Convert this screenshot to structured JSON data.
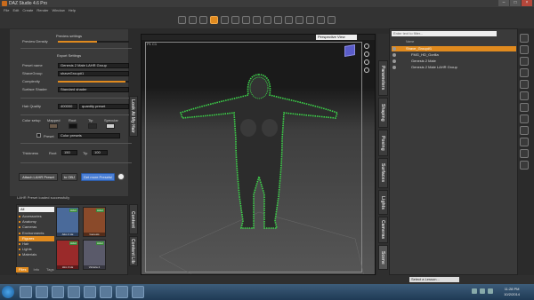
{
  "app": {
    "title": "DAZ Studio 4.6 Pro"
  },
  "menu": [
    "File",
    "Edit",
    "Create",
    "Render",
    "Window",
    "Help"
  ],
  "left_panel": {
    "preview_settings_title": "Preview settings",
    "preview_density_label": "Preview Density",
    "preview_density_fraction": 0.55,
    "export_settings_title": "Export Settings",
    "preset_name_label": "Preset name",
    "preset_name_value": "Genesis 2 Male LAHR Group",
    "shave_group_label": "ShaveGroup",
    "shave_group_value": "shaveGroup#1",
    "complexity_label": "Complexity",
    "complexity_fraction": 0.95,
    "surface_shader_label": "Surface Shader",
    "surface_shader_value": "Standard shader",
    "hair_quality_label": "Hair Quality",
    "hair_quality_value": "400000",
    "hair_quality_preset": "quantity preset",
    "color_setup_label": "Color setup",
    "color_cols": [
      "Mapped",
      "Root",
      "Tip",
      "Specular"
    ],
    "color_swatches": [
      "#6b5a4a",
      "#111111",
      "#2a2a2a",
      "#cfcfcf"
    ],
    "preset_label": "Preset",
    "color_presets_value": "Color presets",
    "thickness_label": "Thickness",
    "root_label": "Root",
    "root_value": "150",
    "tip_label": "Tip",
    "tip_value": "100",
    "attach_button": "Attach LAHR Preset",
    "to_obj_button": "to OBJ",
    "get_more_button": "Get more Presets!",
    "status_message": "LAHR Preset loaded successfully",
    "tab_look_at_hair": "Look At My Hair",
    "tab_content": "Content",
    "tab_content_lib": "Content Lib"
  },
  "content_library": {
    "filter": "All",
    "categories": [
      "Accessories",
      "Anatomy",
      "Cameras",
      "Environments",
      "Figures",
      "Hair",
      "Lights",
      "Materials"
    ],
    "selected_category": "Figures",
    "thumbs": [
      {
        "caption": "Aiko 3 LE",
        "badge": "Actor",
        "color": "#4a6a9a"
      },
      {
        "caption": "Genesis",
        "badge": "Actor",
        "color": "#8a4a2a"
      },
      {
        "caption": "Hiro 3 LE",
        "badge": "Actor",
        "color": "#9a2a2a"
      },
      {
        "caption": "Victoria 4",
        "badge": "Actor",
        "color": "#5a5a6a"
      }
    ],
    "tabs": [
      "Files",
      "Info",
      "Tags"
    ],
    "active_tab": "Files"
  },
  "viewport": {
    "view_dropdown": "Perspective View",
    "frame_label": "P1 C1"
  },
  "right_tabs": [
    "Parameters",
    "Shaping",
    "Posing",
    "Surfaces",
    "Lights",
    "Cameras",
    "Scene"
  ],
  "scene": {
    "filter_placeholder": "Enter text to filter...",
    "col_name": "Name",
    "rows": [
      {
        "label": "Shave_Group#1",
        "selected": true,
        "indent": 0
      },
      {
        "label": "FMG_HD_Gorilla",
        "selected": false,
        "indent": 1
      },
      {
        "label": "Genesis 2 Male",
        "selected": false,
        "indent": 1
      },
      {
        "label": "Genesis 2 Male LAHR Group",
        "selected": false,
        "indent": 1
      }
    ]
  },
  "lesson": {
    "placeholder": "Select a Lesson..."
  },
  "taskbar": {
    "time": "11:28 PM",
    "date": "10/2/2014"
  }
}
